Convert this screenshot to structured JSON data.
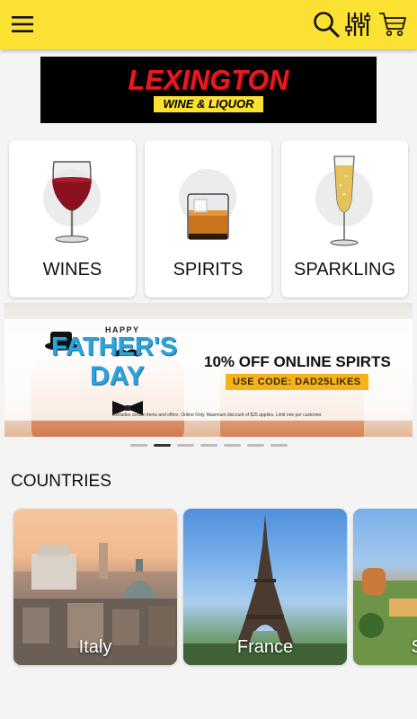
{
  "header": {
    "icons": [
      "menu-icon",
      "search-icon",
      "filter-icon",
      "cart-icon"
    ],
    "background_color": "#fbe232"
  },
  "logo": {
    "main": "LEXINGTON",
    "sub": "WINE & LIQUOR"
  },
  "categories": [
    {
      "label": "WINES",
      "icon": "wine-glass-icon"
    },
    {
      "label": "SPIRITS",
      "icon": "whiskey-glass-icon"
    },
    {
      "label": "SPARKLING",
      "icon": "champagne-flute-icon"
    }
  ],
  "promo": {
    "happy": "HAPPY",
    "line1": "FATHER'S",
    "line2": "DAY",
    "offer": "10% OFF ONLINE SPIRTS",
    "code": "USE CODE: DAD25LIKES",
    "fine_print": "Excludes certain items and offers. Online Only. Maximum discount of $25 applies. Limit one per customer.",
    "slide_count": 7,
    "active_slide": 1
  },
  "countries": {
    "title": "COUNTRIES",
    "items": [
      {
        "name": "Italy"
      },
      {
        "name": "France"
      },
      {
        "name": "S"
      }
    ]
  }
}
